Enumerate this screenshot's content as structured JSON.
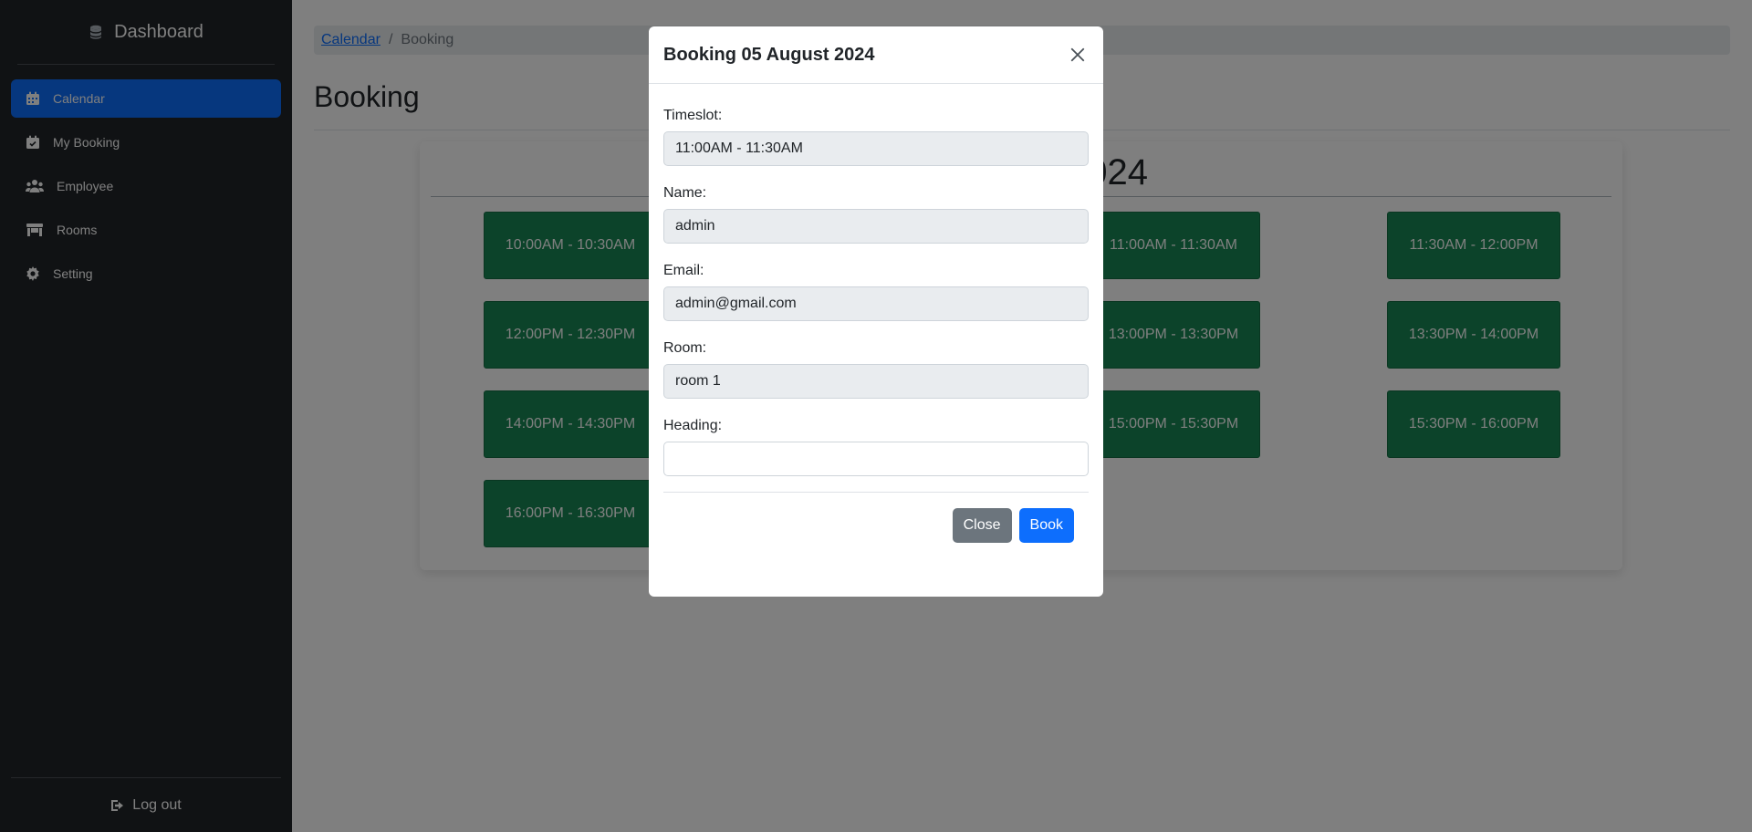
{
  "sidebar": {
    "brand": "Dashboard",
    "items": [
      {
        "label": "Calendar",
        "icon": "calendar-icon",
        "active": true
      },
      {
        "label": "My Booking",
        "icon": "calendar-check-icon",
        "active": false
      },
      {
        "label": "Employee",
        "icon": "users-icon",
        "active": false
      },
      {
        "label": "Rooms",
        "icon": "store-icon",
        "active": false
      },
      {
        "label": "Setting",
        "icon": "gear-icon",
        "active": false
      }
    ],
    "logout": "Log out"
  },
  "breadcrumb": {
    "link": "Calendar",
    "separator": "/",
    "current": "Booking"
  },
  "page_title": "Booking",
  "card": {
    "title_visible": "024",
    "slots": [
      "10:00AM - 10:30AM",
      "11:00AM - 11:30AM",
      "11:30AM - 12:00PM",
      "12:00PM - 12:30PM",
      "13:00PM - 13:30PM",
      "13:30PM - 14:00PM",
      "14:00PM - 14:30PM",
      "15:00PM - 15:30PM",
      "15:30PM - 16:00PM",
      "16:00PM - 16:30PM"
    ]
  },
  "modal": {
    "title": "Booking 05 August 2024",
    "fields": {
      "timeslot": {
        "label": "Timeslot:",
        "value": "11:00AM - 11:30AM"
      },
      "name": {
        "label": "Name:",
        "value": "admin"
      },
      "email": {
        "label": "Email:",
        "value": "admin@gmail.com"
      },
      "room": {
        "label": "Room:",
        "value": "room 1"
      },
      "heading": {
        "label": "Heading:",
        "value": ""
      }
    },
    "buttons": {
      "close": "Close",
      "book": "Book"
    }
  },
  "colors": {
    "sidebar_bg": "#212529",
    "accent": "#0d6efd",
    "slot_green": "#198754",
    "secondary": "#6c757d"
  }
}
